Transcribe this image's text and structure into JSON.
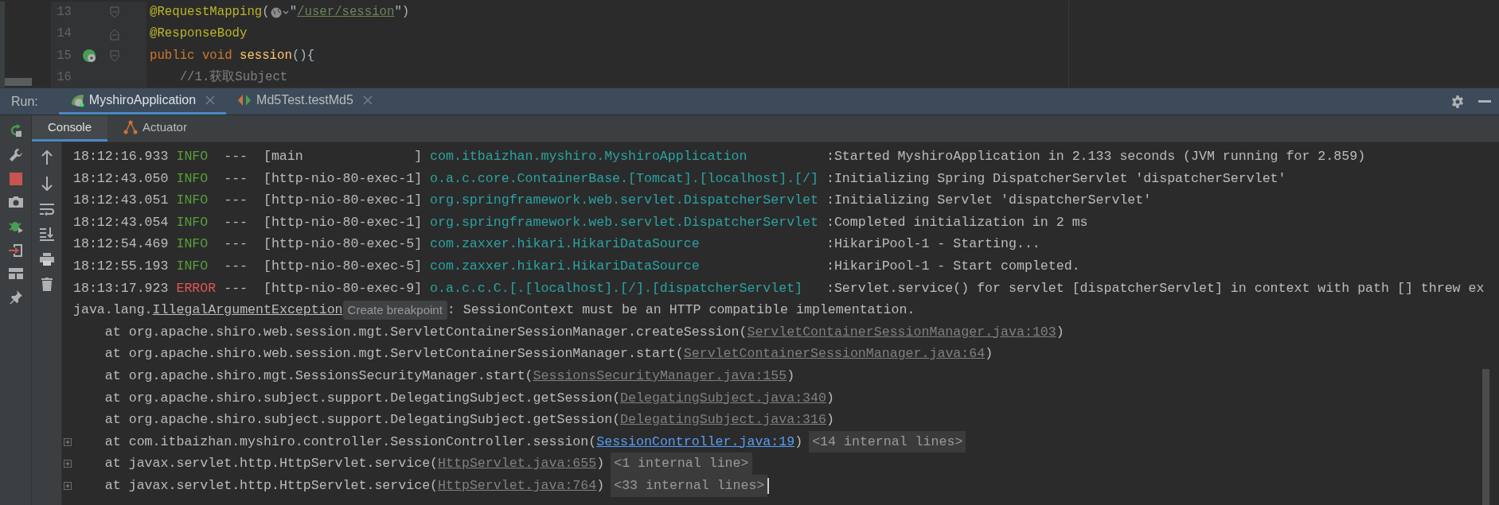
{
  "editor": {
    "lines": [
      {
        "number": "13",
        "kind": "opener",
        "run_icon": false,
        "tokens": [
          {
            "kind": "annotation",
            "text": "@RequestMapping"
          },
          {
            "kind": "plain",
            "text": "("
          },
          {
            "kind": "globe"
          },
          {
            "kind": "plain",
            "text": "\""
          },
          {
            "kind": "url",
            "text": "/user/session"
          },
          {
            "kind": "plain",
            "text": "\")"
          }
        ]
      },
      {
        "number": "14",
        "kind": "closer",
        "run_icon": false,
        "tokens": [
          {
            "kind": "annotation",
            "text": "@ResponseBody"
          }
        ]
      },
      {
        "number": "15",
        "kind": "opener",
        "run_icon": true,
        "tokens": [
          {
            "kind": "keyword",
            "text": "public void "
          },
          {
            "kind": "method",
            "text": "session"
          },
          {
            "kind": "plain",
            "text": "(){"
          }
        ]
      },
      {
        "number": "16",
        "kind": "body",
        "run_icon": false,
        "tokens": [
          {
            "kind": "comment",
            "text": "    //1.获取Subject"
          }
        ]
      }
    ]
  },
  "run_bar": {
    "label": "Run:",
    "tabs": [
      {
        "label": "MyshiroApplication",
        "selected": true
      },
      {
        "label": "Md5Test.testMd5",
        "selected": false
      }
    ]
  },
  "console_tabs": [
    {
      "label": "Console",
      "selected": true
    },
    {
      "label": "Actuator",
      "selected": false
    }
  ],
  "console": {
    "lines": [
      {
        "kind": "log",
        "time": "18:12:16.933",
        "level": "INFO",
        "separator": "---",
        "thread": "[main              ]",
        "logger": "com.itbaizhan.myshiro.MyshiroApplication",
        "message": ":Started MyshiroApplication in 2.133 seconds (JVM running for 2.859)"
      },
      {
        "kind": "log",
        "time": "18:12:43.050",
        "level": "INFO",
        "separator": "---",
        "thread": "[http-nio-80-exec-1]",
        "logger": "o.a.c.core.ContainerBase.[Tomcat].[localhost].[/]",
        "message": ":Initializing Spring DispatcherServlet 'dispatcherServlet'"
      },
      {
        "kind": "log",
        "time": "18:12:43.051",
        "level": "INFO",
        "separator": "---",
        "thread": "[http-nio-80-exec-1]",
        "logger": "org.springframework.web.servlet.DispatcherServlet",
        "message": ":Initializing Servlet 'dispatcherServlet'"
      },
      {
        "kind": "log",
        "time": "18:12:43.054",
        "level": "INFO",
        "separator": "---",
        "thread": "[http-nio-80-exec-1]",
        "logger": "org.springframework.web.servlet.DispatcherServlet",
        "message": ":Completed initialization in 2 ms"
      },
      {
        "kind": "log",
        "time": "18:12:54.469",
        "level": "INFO",
        "separator": "---",
        "thread": "[http-nio-80-exec-5]",
        "logger": "com.zaxxer.hikari.HikariDataSource",
        "message": ":HikariPool-1 - Starting..."
      },
      {
        "kind": "log",
        "time": "18:12:55.193",
        "level": "INFO",
        "separator": "---",
        "thread": "[http-nio-80-exec-5]",
        "logger": "com.zaxxer.hikari.HikariDataSource",
        "message": ":HikariPool-1 - Start completed."
      },
      {
        "kind": "log",
        "time": "18:13:17.923",
        "level": "ERROR",
        "separator": "---",
        "thread": "[http-nio-80-exec-9]",
        "logger": "o.a.c.c.C.[.[localhost].[/].[dispatcherServlet]",
        "message": ":Servlet.service() for servlet [dispatcherServlet] in context with path [] threw ex"
      },
      {
        "kind": "exception",
        "prefix": "java.lang.",
        "class_link": "IllegalArgumentException",
        "tooltip": "Create breakpoint",
        "message": ": SessionContext must be an HTTP compatible implementation."
      },
      {
        "kind": "frame",
        "call": "at org.apache.shiro.web.session.mgt.ServletContainerSessionManager.createSession(",
        "file": "ServletContainerSessionManager.java:103",
        "suffix": ")",
        "user_code": false,
        "expandable": false
      },
      {
        "kind": "frame",
        "call": "at org.apache.shiro.web.session.mgt.ServletContainerSessionManager.start(",
        "file": "ServletContainerSessionManager.java:64",
        "suffix": ")",
        "user_code": false,
        "expandable": false
      },
      {
        "kind": "frame",
        "call": "at org.apache.shiro.mgt.SessionsSecurityManager.start(",
        "file": "SessionsSecurityManager.java:155",
        "suffix": ")",
        "user_code": false,
        "expandable": false
      },
      {
        "kind": "frame",
        "call": "at org.apache.shiro.subject.support.DelegatingSubject.getSession(",
        "file": "DelegatingSubject.java:340",
        "suffix": ")",
        "user_code": false,
        "expandable": false
      },
      {
        "kind": "frame",
        "call": "at org.apache.shiro.subject.support.DelegatingSubject.getSession(",
        "file": "DelegatingSubject.java:316",
        "suffix": ")",
        "user_code": false,
        "expandable": false
      },
      {
        "kind": "frame",
        "call": "at com.itbaizhan.myshiro.controller.SessionController.session(",
        "file": "SessionController.java:19",
        "suffix": ")",
        "user_code": true,
        "expandable": true,
        "folded": "<14 internal lines>"
      },
      {
        "kind": "frame",
        "call": "at javax.servlet.http.HttpServlet.service(",
        "file": "HttpServlet.java:655",
        "suffix": ")",
        "user_code": false,
        "expandable": true,
        "folded": "<1 internal line>"
      },
      {
        "kind": "frame",
        "call": "at javax.servlet.http.HttpServlet.service(",
        "file": "HttpServlet.java:764",
        "suffix": ")",
        "user_code": false,
        "expandable": true,
        "folded": "<33 internal lines>",
        "caret": true
      }
    ]
  }
}
